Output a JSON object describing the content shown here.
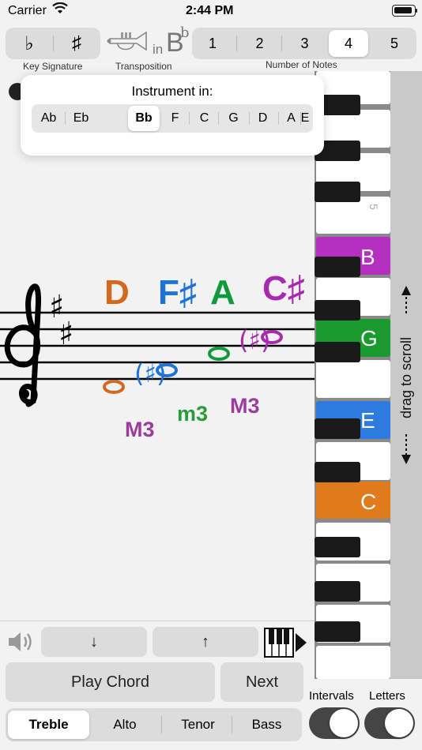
{
  "status_bar": {
    "carrier": "Carrier",
    "time": "2:44 PM"
  },
  "toolbar": {
    "key_signature": {
      "flat_symbol": "♭",
      "sharp_symbol": "♯",
      "caption": "Key Signature"
    },
    "transposition": {
      "in_label": "in",
      "key_letter": "B",
      "key_accidental": "b",
      "caption": "Transposition"
    },
    "number_of_notes": {
      "options": [
        "1",
        "2",
        "3",
        "4",
        "5"
      ],
      "selected": "4",
      "caption": "Number of Notes"
    }
  },
  "instrument_popup": {
    "title": "Instrument in:",
    "options": [
      "Ab",
      "Eb",
      "Bb",
      "F",
      "C",
      "G",
      "D",
      "A",
      "E"
    ],
    "selected": "Bb"
  },
  "score": {
    "clef": "treble",
    "key_accidentals": [
      "♯",
      "♯"
    ],
    "note_names": [
      {
        "text": "D",
        "color": "#d2691e"
      },
      {
        "text": "F♯",
        "color": "#1f73d4"
      },
      {
        "text": "A",
        "color": "#119a3c"
      },
      {
        "text": "C♯",
        "color": "#a82aae"
      }
    ],
    "intervals": [
      {
        "text": "M3",
        "color": "#9c3a9e"
      },
      {
        "text": "m3",
        "color": "#2a9a3c"
      },
      {
        "text": "M3",
        "color": "#9c3a9e"
      }
    ]
  },
  "piano": {
    "octave_label": "5",
    "highlighted_keys": [
      {
        "letter": "B",
        "color": "#b52fc0"
      },
      {
        "letter": "G",
        "color": "#1b9a2f"
      },
      {
        "letter": "E",
        "color": "#2d7be0"
      },
      {
        "letter": "C",
        "color": "#e07b1c"
      }
    ],
    "scroll_label": "drag to scroll"
  },
  "controls": {
    "down_arrow": "↓",
    "up_arrow": "↑",
    "play_chord": "Play Chord",
    "next": "Next",
    "clefs": [
      "Treble",
      "Alto",
      "Tenor",
      "Bass"
    ],
    "selected_clef": "Treble",
    "intervals_label": "Intervals",
    "letters_label": "Letters",
    "intervals_on": false,
    "letters_on": false
  }
}
